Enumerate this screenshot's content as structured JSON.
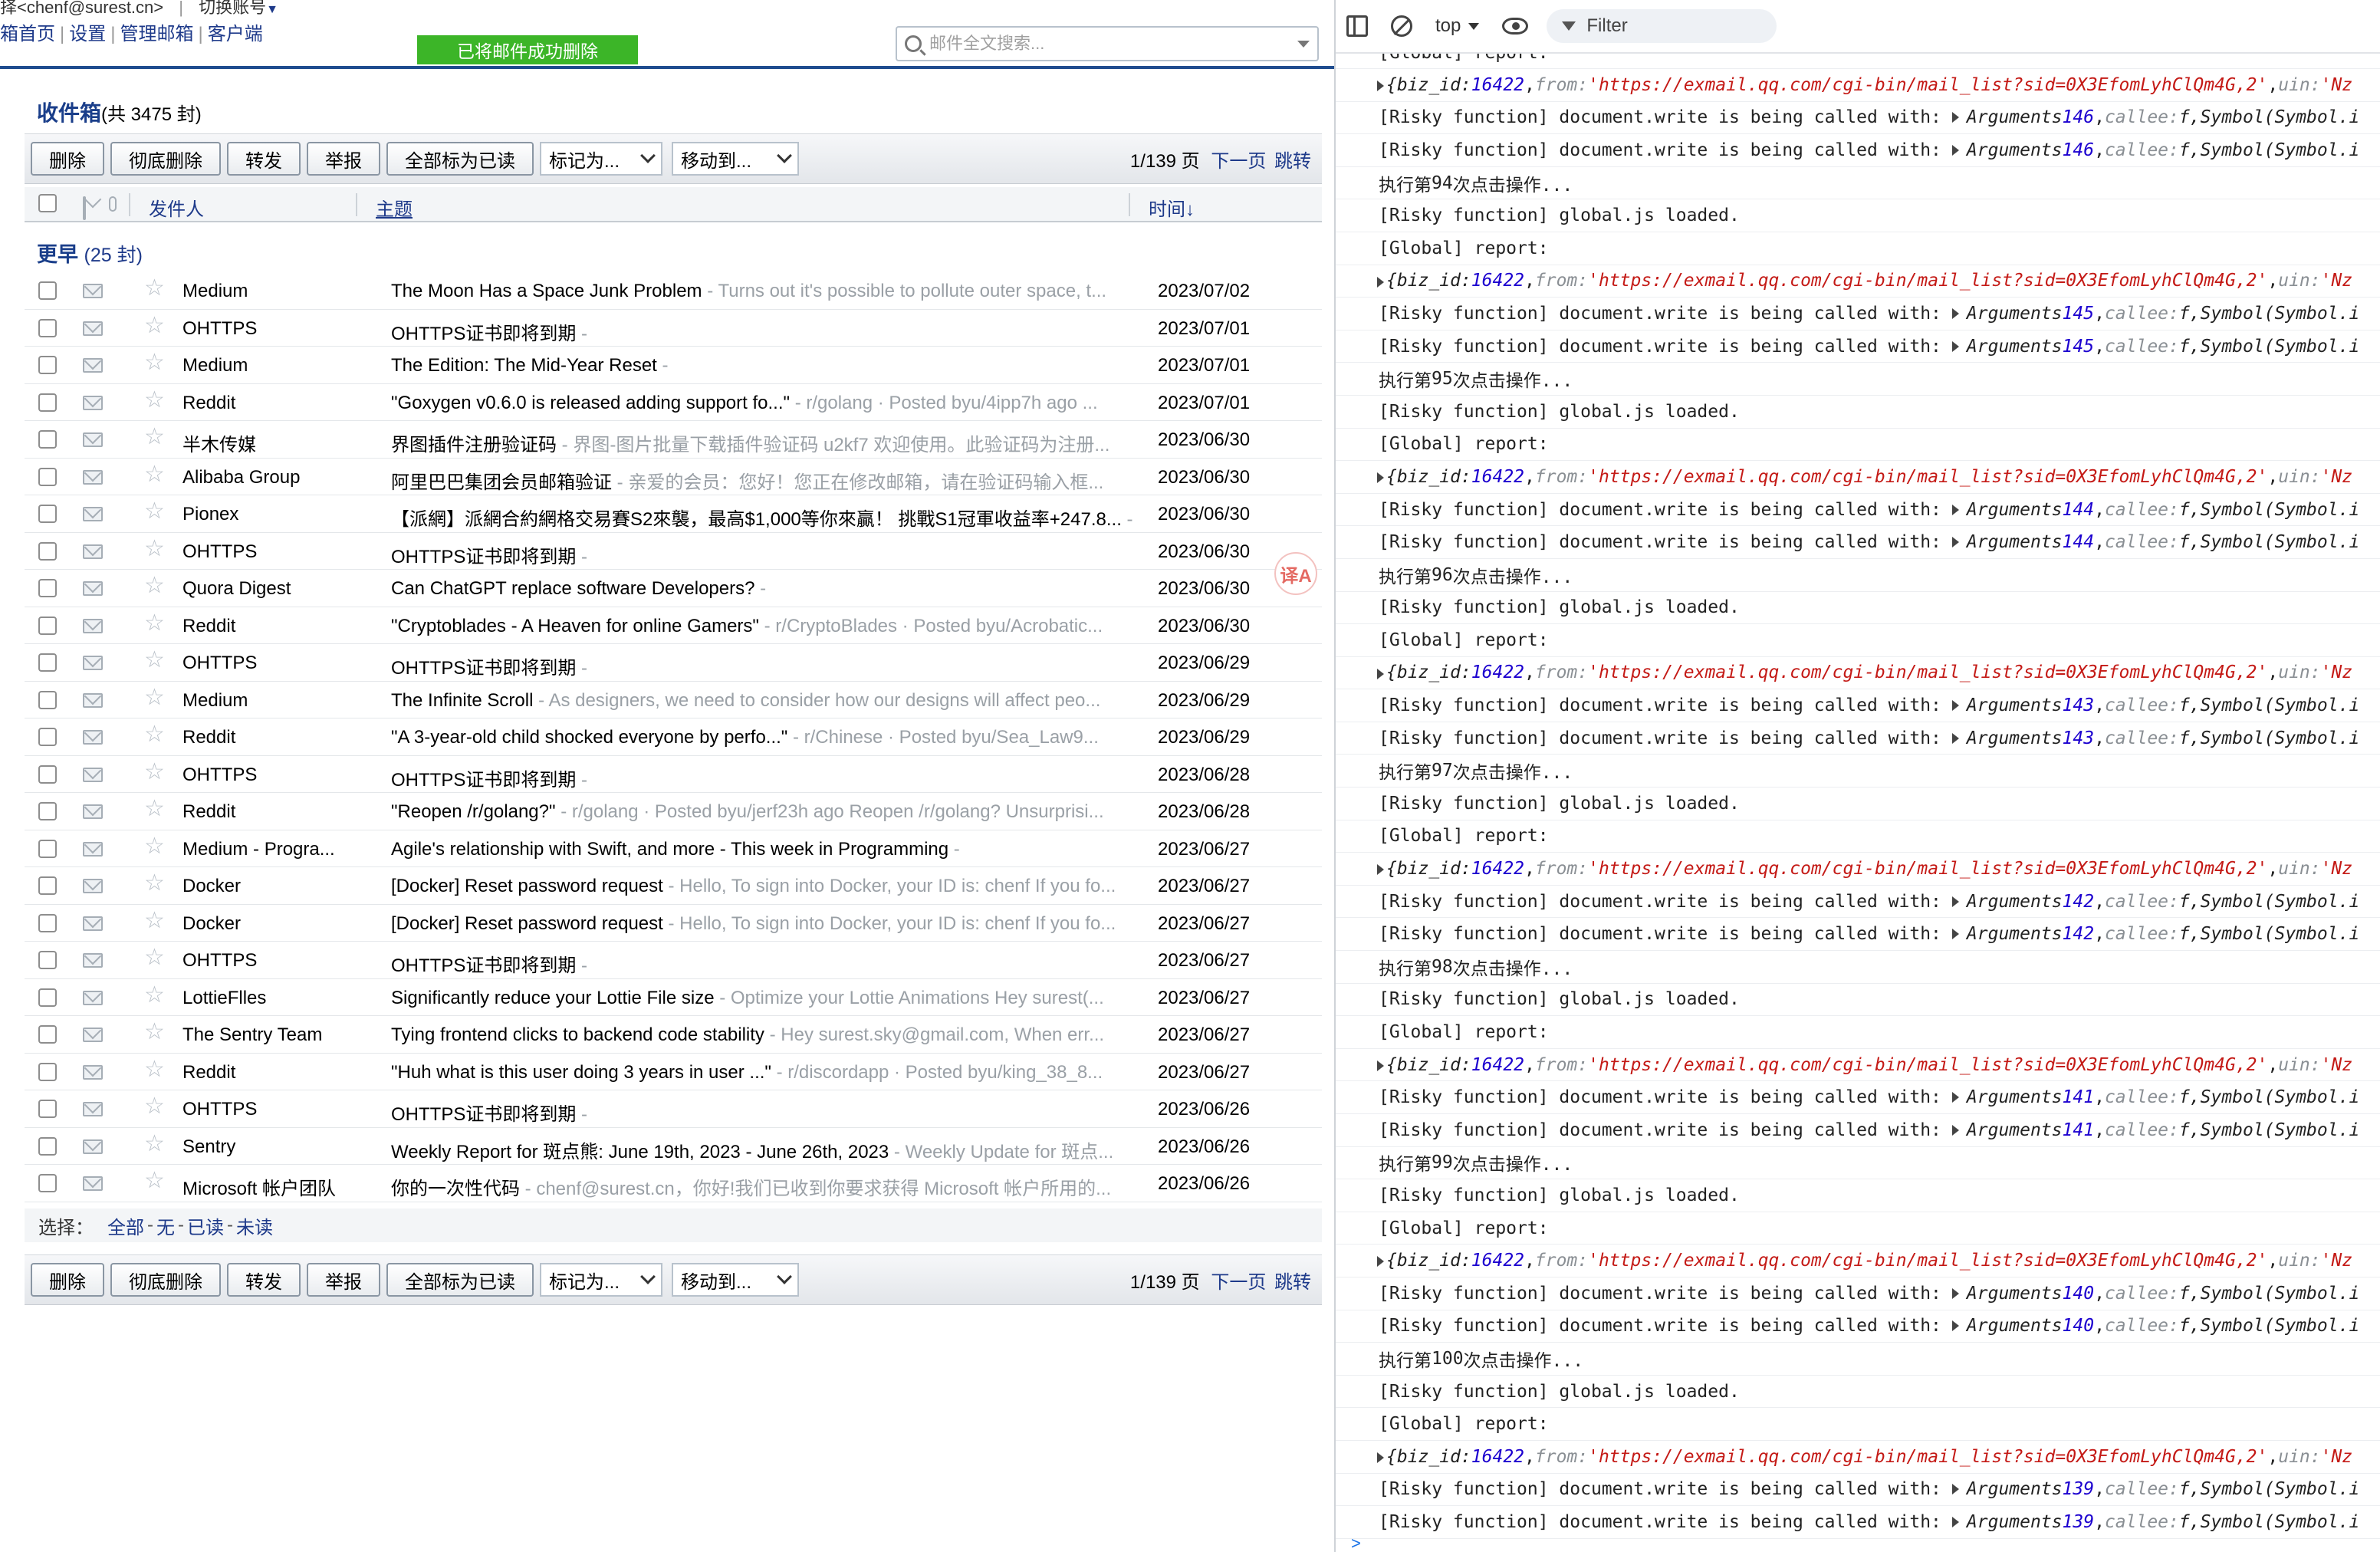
{
  "account": {
    "email": "chenf@surest.cn",
    "prefix": "择",
    "switch_label": "切换账号"
  },
  "nav": {
    "items": [
      "箱首页",
      "设置",
      "管理邮箱",
      "客户端"
    ]
  },
  "toast": "已将邮件成功删除",
  "search": {
    "placeholder": "邮件全文搜索..."
  },
  "inbox": {
    "title": "收件箱",
    "count_text": "(共 3475 封)"
  },
  "toolbar": {
    "buttons": [
      "删除",
      "彻底删除",
      "转发",
      "举报",
      "全部标为已读"
    ],
    "mark_as": "标记为...",
    "move_to": "移动到...",
    "page_info": "1/139 页",
    "next_page": "下一页",
    "jump": "跳转"
  },
  "columns": {
    "from": "发件人",
    "subject": "主题",
    "time": "时间↓"
  },
  "group": {
    "label": "更早",
    "count": "(25 封)"
  },
  "emails": [
    {
      "from": "Medium",
      "subject": "The Moon Has a Space Junk Problem",
      "preview": "Turns out it's possible to pollute outer space, t...",
      "date": "2023/07/02"
    },
    {
      "from": "OHTTPS",
      "subject": "OHTTPS证书即将到期",
      "preview": "",
      "date": "2023/07/01"
    },
    {
      "from": "Medium",
      "subject": "The Edition: The Mid-Year Reset",
      "preview": "",
      "date": "2023/07/01"
    },
    {
      "from": "Reddit",
      "subject": "\"Goxygen v0.6.0 is released adding support fo...\"",
      "preview": "r/golang · Posted byu/4ipp7h ago ...",
      "date": "2023/07/01"
    },
    {
      "from": "半木传媒",
      "subject": "界图插件注册验证码",
      "preview": "界图-图片批量下载插件验证码 u2kf7 欢迎使用。此验证码为注册...",
      "date": "2023/06/30"
    },
    {
      "from": "Alibaba Group",
      "subject": "阿里巴巴集团会员邮箱验证",
      "preview": "亲爱的会员：您好！您正在修改邮箱，请在验证码输入框...",
      "date": "2023/06/30"
    },
    {
      "from": "Pionex",
      "subject": "【派網】派網合約網格交易賽S2來襲，最高$1,000等你來贏！ 挑戰S1冠軍收益率+247.8...",
      "preview": "",
      "date": "2023/06/30"
    },
    {
      "from": "OHTTPS",
      "subject": "OHTTPS证书即将到期",
      "preview": "",
      "date": "2023/06/30"
    },
    {
      "from": "Quora Digest",
      "subject": "Can ChatGPT replace software Developers?",
      "preview": "",
      "date": "2023/06/30"
    },
    {
      "from": "Reddit",
      "subject": "\"Cryptoblades - A Heaven for online Gamers\"",
      "preview": "r/CryptoBlades · Posted byu/Acrobatic...",
      "date": "2023/06/30"
    },
    {
      "from": "OHTTPS",
      "subject": "OHTTPS证书即将到期",
      "preview": "",
      "date": "2023/06/29"
    },
    {
      "from": "Medium",
      "subject": "The Infinite Scroll",
      "preview": "As designers, we need to consider how our designs will affect peo...",
      "date": "2023/06/29"
    },
    {
      "from": "Reddit",
      "subject": "\"A 3-year-old child shocked everyone by perfo...\"",
      "preview": "r/Chinese · Posted byu/Sea_Law9...",
      "date": "2023/06/29"
    },
    {
      "from": "OHTTPS",
      "subject": "OHTTPS证书即将到期",
      "preview": "",
      "date": "2023/06/28"
    },
    {
      "from": "Reddit",
      "subject": "\"Reopen /r/golang?\"",
      "preview": "r/golang · Posted byu/jerf23h ago Reopen /r/golang? Unsurprisi...",
      "date": "2023/06/28"
    },
    {
      "from": "Medium - Progra...",
      "subject": "Agile's relationship with Swift, and more - This week in Programming",
      "preview": "",
      "date": "2023/06/27"
    },
    {
      "from": "Docker",
      "subject": "[Docker] Reset password request",
      "preview": "Hello, To sign into Docker, your ID is: chenf If you fo...",
      "date": "2023/06/27"
    },
    {
      "from": "Docker",
      "subject": "[Docker] Reset password request",
      "preview": "Hello, To sign into Docker, your ID is: chenf If you fo...",
      "date": "2023/06/27"
    },
    {
      "from": "OHTTPS",
      "subject": "OHTTPS证书即将到期",
      "preview": "",
      "date": "2023/06/27"
    },
    {
      "from": "LottieFlles",
      "subject": "Significantly reduce your Lottie File size",
      "preview": "Optimize your Lottie Animations Hey surest(...",
      "date": "2023/06/27"
    },
    {
      "from": "The Sentry Team",
      "subject": "Tying frontend clicks to backend code stability",
      "preview": "Hey surest.sky@gmail.com, When err...",
      "date": "2023/06/27"
    },
    {
      "from": "Reddit",
      "subject": "\"Huh what is this user doing 3 years in user ...\"",
      "preview": "r/discordapp · Posted byu/king_38_8...",
      "date": "2023/06/27"
    },
    {
      "from": "OHTTPS",
      "subject": "OHTTPS证书即将到期",
      "preview": "",
      "date": "2023/06/26"
    },
    {
      "from": "Sentry",
      "subject": "Weekly Report for 斑点熊: June 19th, 2023 - June 26th, 2023",
      "preview": "Weekly Update for 斑点...",
      "date": "2023/06/26"
    },
    {
      "from": "Microsoft 帐户团队",
      "subject": "你的一次性代码",
      "preview": "chenf@surest.cn，你好!我们已收到你要求获得 Microsoft 帐户所用的...",
      "date": "2023/06/26"
    }
  ],
  "select_bar": {
    "label": "选择：",
    "options": [
      "全部",
      "无",
      "已读",
      "未读"
    ]
  },
  "translate_fab": "译A",
  "devtools": {
    "context": "top",
    "filter_placeholder": "Filter",
    "top_cut_text": "[Global] report:",
    "report_label": "[Global] report:",
    "loaded_msg": "[Risky function] global.js loaded.",
    "risky_prefix": "[Risky function] document.write is being called with:",
    "biz_id": "16422",
    "url": "'https://exmail.qq.com/cgi-bin/mail_list?sid=0X3EfomLyhClQm4G,2'",
    "obj_prefix": "{biz_id:",
    "obj_from": "from:",
    "obj_uin": "uin:",
    "obj_tail": "'Nz",
    "args_label": "Arguments",
    "callee_label": "callee:",
    "f_label": "f,",
    "symbol_label": "Symbol(Symbol.i",
    "exec_pre": "执行第",
    "exec_post": "次点击操作...",
    "prompt": ">",
    "first_blocks": [
      {
        "args_n": "146"
      }
    ],
    "blocks": [
      {
        "exec": "94",
        "args_n": "145"
      },
      {
        "exec": "95",
        "args_n": "144"
      },
      {
        "exec": "96",
        "args_n": "143"
      },
      {
        "exec": "97",
        "args_n": "142"
      },
      {
        "exec": "98",
        "args_n": "141"
      },
      {
        "exec": "99",
        "args_n": "140"
      },
      {
        "exec": "100",
        "args_n": "139"
      }
    ]
  }
}
